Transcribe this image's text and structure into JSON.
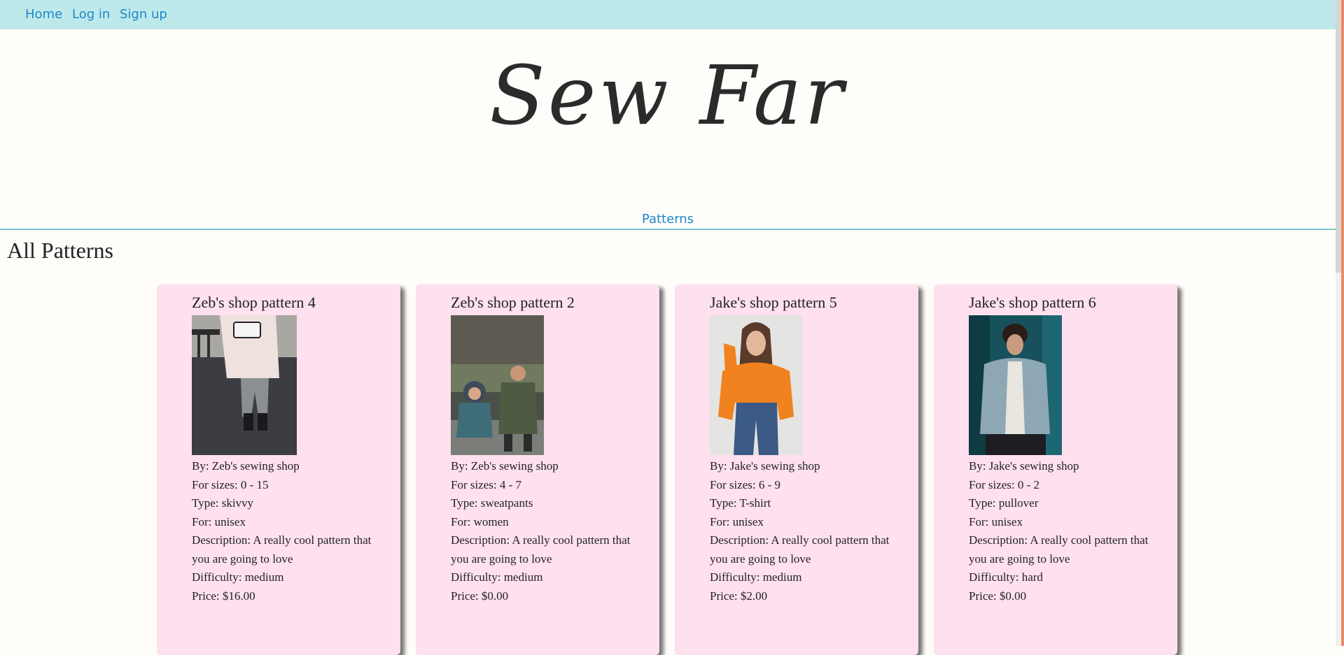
{
  "nav": {
    "home": "Home",
    "login": "Log in",
    "signup": "Sign up"
  },
  "site_title": "Sew Far",
  "subnav": {
    "patterns": "Patterns"
  },
  "page_heading": "All Patterns",
  "cards": [
    {
      "title": "Zeb's shop pattern 4",
      "image": "person-in-plaid-pants-photo",
      "by": "By: Zeb's sewing shop",
      "sizes": "For sizes: 0 - 15",
      "type": "Type: skivvy",
      "for": "For: unisex",
      "description": "Description: A really cool pattern that you are going to love",
      "difficulty": "Difficulty: medium",
      "price": "Price: $16.00"
    },
    {
      "title": "Zeb's shop pattern 2",
      "image": "two-children-in-jackets-photo",
      "by": "By: Zeb's sewing shop",
      "sizes": "For sizes: 4 - 7",
      "type": "Type: sweatpants",
      "for": "For: women",
      "description": "Description: A really cool pattern that you are going to love",
      "difficulty": "Difficulty: medium",
      "price": "Price: $0.00"
    },
    {
      "title": "Jake's shop pattern 5",
      "image": "woman-in-orange-sweater-photo",
      "by": "By: Jake's sewing shop",
      "sizes": "For sizes: 6 - 9",
      "type": "Type: T-shirt",
      "for": "For: unisex",
      "description": "Description: A really cool pattern that you are going to love",
      "difficulty": "Difficulty: medium",
      "price": "Price: $2.00"
    },
    {
      "title": "Jake's shop pattern 6",
      "image": "man-in-denim-jacket-photo",
      "by": "By: Jake's sewing shop",
      "sizes": "For sizes: 0 - 2",
      "type": "Type: pullover",
      "for": "For: unisex",
      "description": "Description: A really cool pattern that you are going to love",
      "difficulty": "Difficulty: hard",
      "price": "Price: $0.00"
    }
  ],
  "colors": {
    "nav_bg": "#bde9ea",
    "link": "#1f87c9",
    "card_bg": "#ffe0ef",
    "divider": "#7ec3c9",
    "page_bg": "#fefdfa"
  }
}
